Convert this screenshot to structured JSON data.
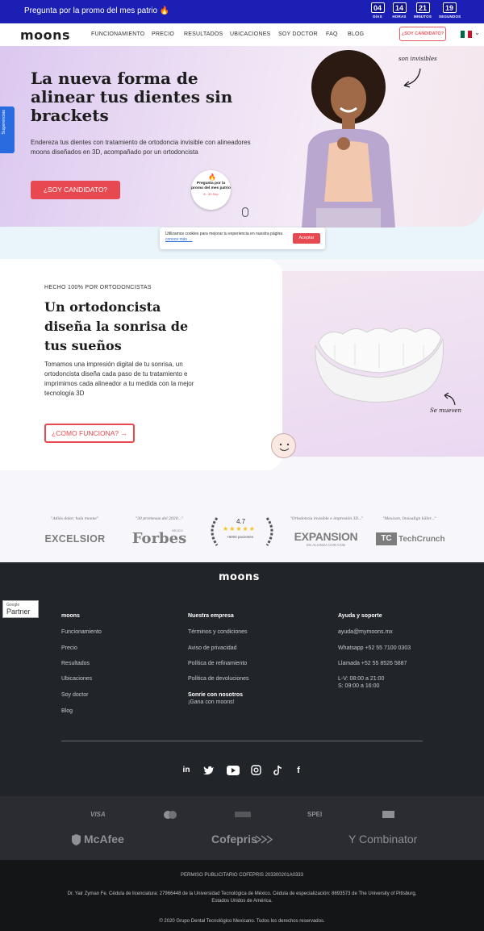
{
  "promo": {
    "text": "Pregunta por la promo del mes patrio 🔥",
    "countdown": [
      {
        "value": "04",
        "label": "DÍAS"
      },
      {
        "value": "14",
        "label": "HORAS"
      },
      {
        "value": "21",
        "label": "MINUTOS"
      },
      {
        "value": "19",
        "label": "SEGUNDOS"
      }
    ]
  },
  "nav": {
    "logo": "moons",
    "links": [
      "FUNCIONAMIENTO",
      "PRECIO",
      "RESULTADOS",
      "UBICACIONES",
      "SOY DOCTOR",
      "FAQ",
      "BLOG"
    ],
    "cta": "¿SOY CANDIDATO?",
    "flag_colors": [
      "#006847",
      "#ffffff",
      "#ce1126"
    ]
  },
  "side_tab": "Sugerencias",
  "hero": {
    "title": "La nueva forma de alinear tus dientes sin brackets",
    "subtitle": "Endereza tus dientes con tratamiento de ortodoncia invisible con alineadores moons diseñados en 3D, acompañado por un ortodoncista",
    "cta": "¿SOY CANDIDATO?",
    "handwriting": "son invisibles",
    "sticker_text": "Pregunta por la promo del mes patrio",
    "sticker_dates": "8 - 30 Sep"
  },
  "cookie": {
    "text": "Utilizamos cookies para mejorar tu experiencia en nuestra página",
    "link": "conoce más →",
    "accept": "Aceptar"
  },
  "section2": {
    "kicker": "HECHO 100% POR ORTODONCISTAS",
    "title": "Un ortodoncista diseña la sonrisa de tus sueños",
    "text": "Tomamos una impresión digital de tu sonrisa, un ortodoncista diseña cada paso de tu tratamiento e imprimimos cada alineador a tu medida con la mejor tecnología 3D",
    "cta": "¿COMO FUNCIONA? →",
    "handwriting": "Se mueven"
  },
  "press": {
    "quotes": [
      "\"Adiós dolor, hola moons\"",
      "\"30 promesas del 2020...\"",
      "",
      "\"Ortodoncia invisible e impresión 3D...\"",
      "\"Mexican, InvisaIign killer...\""
    ],
    "logos": [
      "EXCELSIOR",
      "Forbes",
      "",
      "EXPANSION",
      "TechCrunch"
    ],
    "forbes_small": "MÉXICO",
    "expansion_small": "EN ALIANZA CON CNN",
    "rating": "4.7",
    "stars": "★★★★★",
    "rating_sub": "+6000 pacientes"
  },
  "footer": {
    "logo": "moons",
    "google_partner": {
      "top": "Google",
      "bottom": "Partner"
    },
    "col1": {
      "heading": "moons",
      "links": [
        "Funcionamiento",
        "Precio",
        "Resultados",
        "Ubicaciones",
        "Soy doctor",
        "Blog"
      ]
    },
    "col2": {
      "heading": "Nuestra empresa",
      "links": [
        "Términos y condiciones",
        "Aviso de privacidad",
        "Política de refinamiento",
        "Política de devoluciones"
      ],
      "sub_heading": "Sonríe con nosotros",
      "sub_link": "¡Gana con moons!"
    },
    "col3": {
      "heading": "Ayuda y soporte",
      "links": [
        "ayuda@mymoons.mx",
        "Whatsapp +52 55 7100 0303",
        "Llamada +52 55 8526 5887"
      ],
      "hours1": "L-V: 08:00 a 21:00",
      "hours2": "S: 09:00 a 16:00"
    },
    "social_icons": [
      "linkedin-icon",
      "twitter-icon",
      "youtube-icon",
      "instagram-icon",
      "tiktok-icon",
      "facebook-icon"
    ]
  },
  "trust": {
    "row1": [
      "VISA",
      "",
      "",
      "SPEI",
      ""
    ],
    "row2": [
      "McAfee",
      "Cofepris",
      "Y Combinator"
    ]
  },
  "legal": {
    "permit": "PERMISO PUBLICITARIO COFEPRIS 203300201A0333",
    "doctor": "Dr. Yair Zyman Fe. Cédula de licenciatura: 27966448 de la Universidad Tecnológica de México. Cédula de especialización: 8693573 de The University of Pittsburg, Estados Unidos de América.",
    "copyright": "© 2020 Grupo Dental Tecnológico Mexicano. Todos los derechos reservados."
  }
}
